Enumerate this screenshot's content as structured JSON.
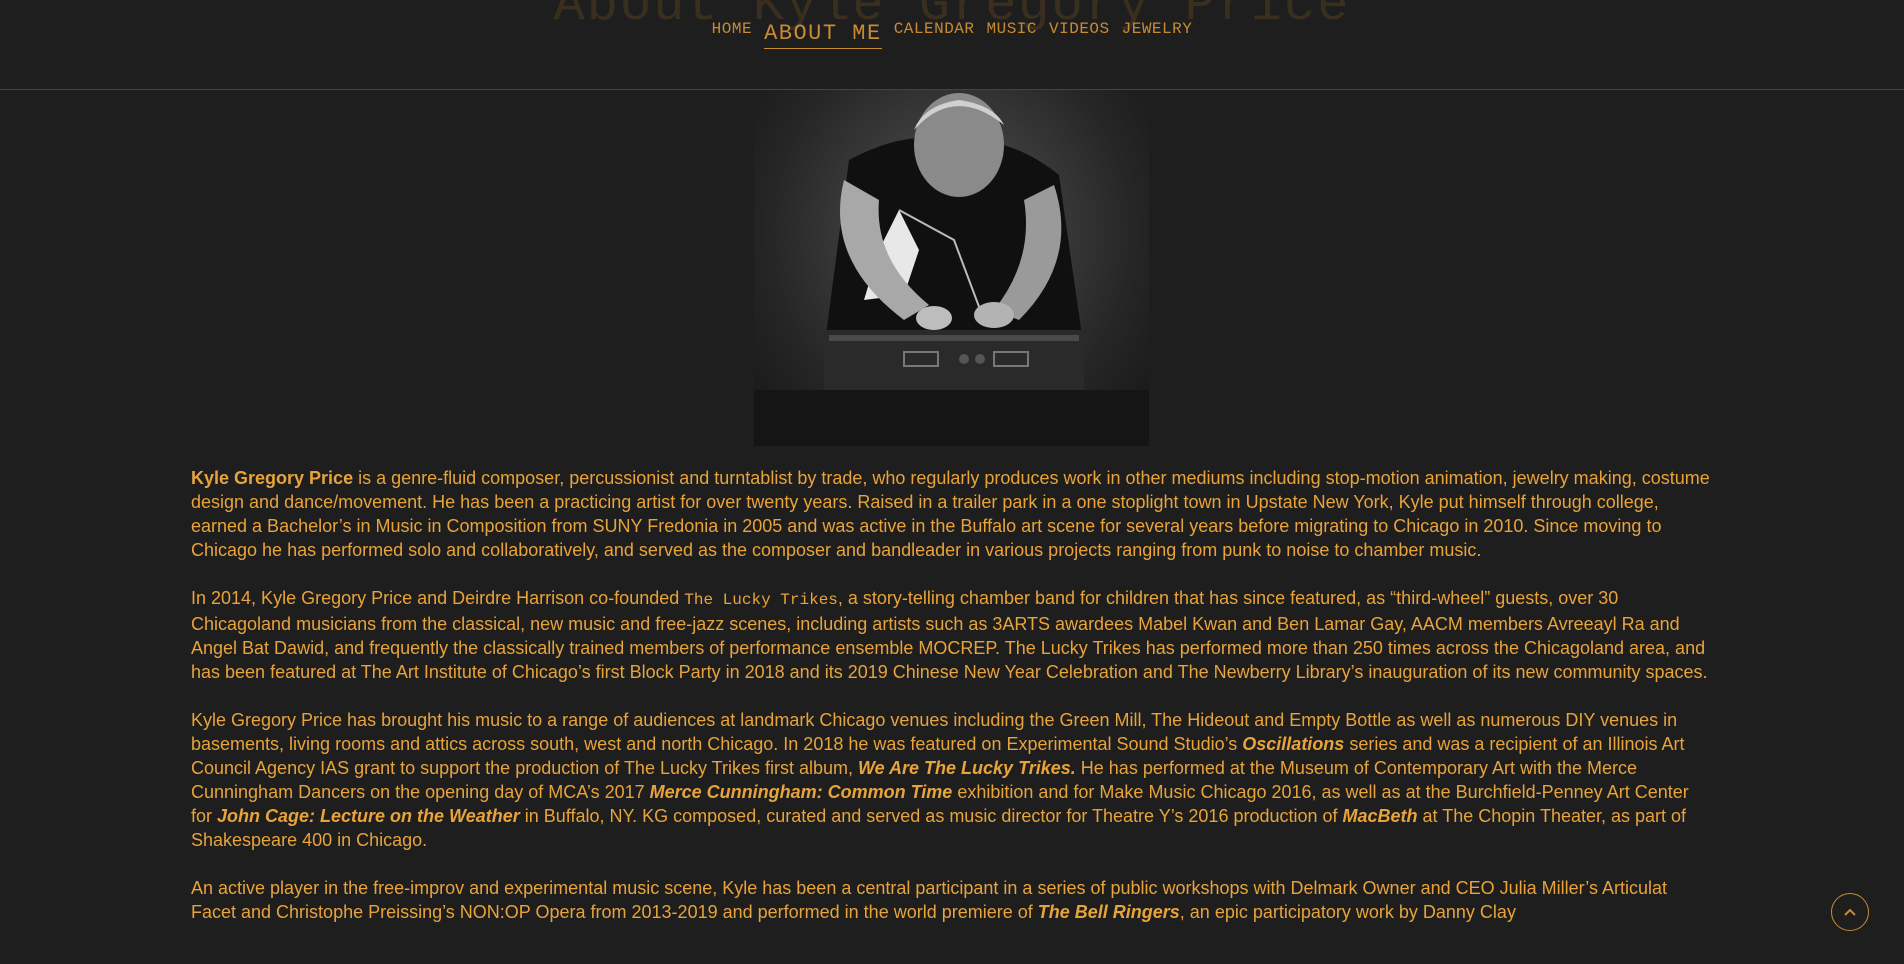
{
  "header": {
    "ghost_title": "About Kyle Gregory Price",
    "nav": {
      "home": "HOME",
      "about": "ABOUT ME",
      "calendar": "CALENDAR",
      "music": "MUSIC",
      "videos": "VIDEOS",
      "jewelry": "JEWELRY"
    }
  },
  "colors": {
    "background": "#1e1e1e",
    "accent": "#e8a33a",
    "nav": "#c98a32"
  },
  "photo": {
    "subject": "artist at electronics table"
  },
  "bio": {
    "p1": {
      "name": "Kyle Gregory Price",
      "text": " is a genre-fluid composer, percussionist and turntablist by trade, who regularly produces work in other mediums including stop-motion animation, jewelry making, costume design and dance/movement. He has been a practicing artist for over twenty years. Raised in a trailer park in a one stoplight town in Upstate New York, Kyle put himself through college, earned a Bachelor’s in Music in Composition from SUNY Fredonia in 2005 and was active in the Buffalo art scene for several years before migrating to Chicago in 2010. Since moving to Chicago he has performed solo and collaboratively, and served as the composer and bandleader in various projects ranging from punk to noise to chamber music."
    },
    "p2": {
      "a": "In 2014, Kyle Gregory Price and Deirdre Harrison co-founded ",
      "band": "The Lucky Trikes",
      "b": ", a story-telling chamber band for children that has since featured, as “third-wheel” guests, over 30 Chicagoland musicians from the classical, new music and free-jazz scenes, including artists such as 3ARTS awardees Mabel Kwan and Ben Lamar Gay, AACM members Avreeayl Ra and Angel Bat Dawid, and frequently the classically trained members of performance ensemble MOCREP. The Lucky Trikes has performed more than 250 times across the Chicagoland area, and has been featured at The Art Institute of Chicago’s first Block Party in 2018 and its 2019 Chinese New Year Celebration and The Newberry Library’s inauguration of its new community spaces."
    },
    "p3": {
      "a": "Kyle Gregory Price has brought his music to a range of audiences at landmark Chicago venues including the Green Mill, The Hideout and Empty Bottle as well as numerous DIY venues in basements, living rooms and attics across south, west and north Chicago. In 2018 he was featured on Experimental Sound Studio’s ",
      "oscillations": "Oscillations",
      "b": " series and was a recipient of an Illinois Art Council Agency IAS grant to support the production of The Lucky Trikes first album, ",
      "album": "We Are The Lucky Trikes.",
      "c": " He has performed at the Museum of Contemporary Art with the Merce Cunningham Dancers on the opening day of MCA’s 2017 ",
      "merce": "Merce Cunningham: Common Time",
      "d": " exhibition and for Make Music Chicago 2016, as well as at the Burchfield-Penney Art Center for ",
      "cage": "John Cage: Lecture on the Weather",
      "e": " in Buffalo, NY. KG composed, curated and served as music director for Theatre Y’s 2016 production of ",
      "macbeth": "MacBeth",
      "f": " at The Chopin Theater, as part of Shakespeare 400 in Chicago."
    },
    "p4": {
      "a": "An active player in the free-improv and experimental music scene, Kyle has been a central participant in a series of public workshops with Delmark Owner and CEO Julia Miller’s Articulat Facet and Christophe Preissing’s NON:OP Opera from 2013-2019 and performed in the world premiere of ",
      "bells": "The Bell Ringers",
      "b": ", an epic participatory work by Danny Clay"
    }
  },
  "scroll_top": {
    "icon": "chevron-up-icon"
  }
}
